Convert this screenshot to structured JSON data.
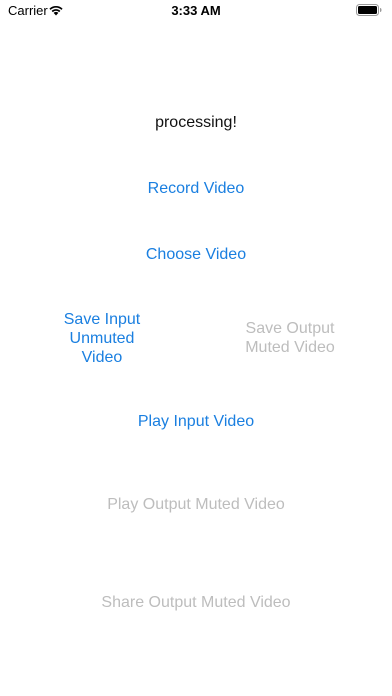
{
  "status_bar": {
    "carrier": "Carrier",
    "time": "3:33 AM",
    "wifi_icon": "wifi-icon",
    "battery_icon": "battery-icon"
  },
  "main": {
    "status_text": "processing!",
    "buttons": {
      "record_video": "Record Video",
      "choose_video": "Choose Video",
      "save_input_unmuted": "Save Input\nUnmuted\nVideo",
      "save_output_muted": "Save Output\nMuted Video",
      "play_input_video": "Play Input Video",
      "play_output_muted": "Play Output Muted Video",
      "share_output_muted": "Share Output Muted Video"
    }
  },
  "colors": {
    "enabled": "#1a7fe0",
    "disabled": "#bdbdbd"
  }
}
